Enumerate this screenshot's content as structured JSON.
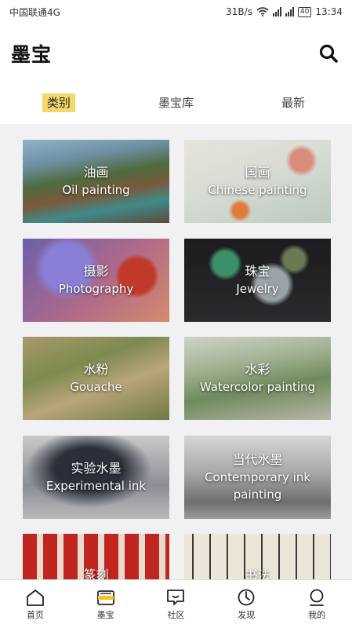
{
  "status_bar": {
    "carrier": "中国联通4G",
    "net_speed": "31B/s",
    "battery": "40",
    "time": "13:34"
  },
  "header": {
    "title": "墨宝"
  },
  "tabs": [
    {
      "label": "类别"
    },
    {
      "label": "墨宝库"
    },
    {
      "label": "最新"
    }
  ],
  "categories": [
    {
      "zh": "油画",
      "en": "Oil painting"
    },
    {
      "zh": "国画",
      "en": "Chinese painting"
    },
    {
      "zh": "摄影",
      "en": "Photography"
    },
    {
      "zh": "珠宝",
      "en": "Jewelry"
    },
    {
      "zh": "水粉",
      "en": "Gouache"
    },
    {
      "zh": "水彩",
      "en": "Watercolor painting"
    },
    {
      "zh": "实验水墨",
      "en": "Experimental ink"
    },
    {
      "zh": "当代水墨",
      "en": "Contemporary ink painting"
    },
    {
      "zh": "篆刻",
      "en": ""
    },
    {
      "zh": "书法",
      "en": ""
    }
  ],
  "bottom_nav": [
    {
      "label": "首页",
      "icon": "home-icon"
    },
    {
      "label": "墨宝",
      "icon": "wallet-icon"
    },
    {
      "label": "社区",
      "icon": "chat-icon"
    },
    {
      "label": "发现",
      "icon": "compass-icon"
    },
    {
      "label": "我的",
      "icon": "profile-icon"
    }
  ],
  "colors": {
    "accent": "#f5d76e",
    "content_bg": "#f1f1f3"
  }
}
